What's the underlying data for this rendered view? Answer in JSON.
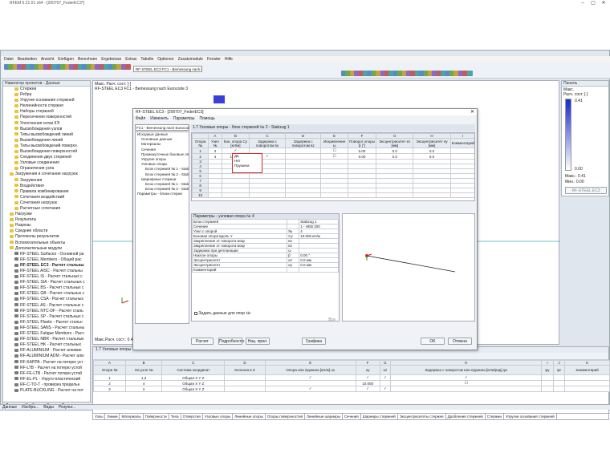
{
  "title": "RFEM 5.21.01 x64 - [200707_FederEC3*]",
  "menu": [
    "Datei",
    "Bearbeiten",
    "Ansicht",
    "Einfügen",
    "Berechnen",
    "Ergebnisse",
    "Extras",
    "Tabelle",
    "Optionen",
    "Zusatzmodule",
    "Fenster",
    "Hilfe"
  ],
  "toolbar": {
    "module_select": "RF-STEEL EC3 FC1 - Bemessung nach E"
  },
  "navigator": {
    "title": "Навигатор проектов - Данные",
    "items": [
      {
        "l": "Стержни",
        "d": 2,
        "i": "folder"
      },
      {
        "l": "Ребра",
        "d": 2,
        "i": "folder"
      },
      {
        "l": "Упругие основания стержней",
        "d": 2,
        "i": "folder"
      },
      {
        "l": "Нелинейности стержня",
        "d": 2,
        "i": "folder"
      },
      {
        "l": "Наборы стержней",
        "d": 2,
        "i": "folder"
      },
      {
        "l": "Пересечения поверхностей",
        "d": 2,
        "i": "folder"
      },
      {
        "l": "Уплотнения сетки КЭ",
        "d": 2,
        "i": "folder"
      },
      {
        "l": "Высвобождения узлов",
        "d": 2,
        "i": "folder"
      },
      {
        "l": "Типы высвобождений линий",
        "d": 2,
        "i": "folder"
      },
      {
        "l": "Высвобождения линий",
        "d": 2,
        "i": "folder"
      },
      {
        "l": "Типы высвобождений поверхн.",
        "d": 2,
        "i": "folder"
      },
      {
        "l": "Высвобождения поверхностей",
        "d": 2,
        "i": "folder"
      },
      {
        "l": "Соединения двух стержней",
        "d": 2,
        "i": "folder"
      },
      {
        "l": "Узловые соединения",
        "d": 2,
        "i": "folder"
      },
      {
        "l": "Ограничения узла",
        "d": 2,
        "i": "folder"
      },
      {
        "l": "Загружения и сочетания нагрузок",
        "d": 1,
        "i": "folder"
      },
      {
        "l": "Загружения",
        "d": 2,
        "i": "folder"
      },
      {
        "l": "Воздействия",
        "d": 2,
        "i": "folder"
      },
      {
        "l": "Правила комбинирования",
        "d": 2,
        "i": "folder"
      },
      {
        "l": "Сочетания воздействий",
        "d": 2,
        "i": "folder"
      },
      {
        "l": "Сочетания нагрузок",
        "d": 2,
        "i": "folder"
      },
      {
        "l": "Расчетные сочетания",
        "d": 2,
        "i": "folder"
      },
      {
        "l": "Нагрузки",
        "d": 1,
        "i": "folder"
      },
      {
        "l": "Результаты",
        "d": 1,
        "i": "folder"
      },
      {
        "l": "Разрезы",
        "d": 1,
        "i": "folder"
      },
      {
        "l": "Средние области",
        "d": 1,
        "i": "folder"
      },
      {
        "l": "Протоколы результатов",
        "d": 1,
        "i": "folder"
      },
      {
        "l": "Вспомогательные объекты",
        "d": 1,
        "i": "folder"
      },
      {
        "l": "Дополнительные модули",
        "d": 1,
        "i": "folder"
      },
      {
        "l": "RF-STEEL Surfaces - Основной ра",
        "d": 2,
        "i": "module"
      },
      {
        "l": "RF-STEEL Members - Общий рас",
        "d": 2,
        "i": "module"
      },
      {
        "l": "RF-STEEL EC3 - Расчет стальны",
        "d": 2,
        "i": "module",
        "b": true
      },
      {
        "l": "RF-STEEL AISC - Расчет стальны",
        "d": 2,
        "i": "module"
      },
      {
        "l": "RF-STEEL IS - Расчет стальных с",
        "d": 2,
        "i": "module"
      },
      {
        "l": "RF-STEEL SIA - Расчет стальных с",
        "d": 2,
        "i": "module"
      },
      {
        "l": "RF-STEEL BS - Расчет стальных с",
        "d": 2,
        "i": "module"
      },
      {
        "l": "RF-STEEL GB - Расчет стальных с",
        "d": 2,
        "i": "module"
      },
      {
        "l": "RF-STEEL CSA - Расчет стальных",
        "d": 2,
        "i": "module"
      },
      {
        "l": "RF-STEEL AS - Расчет стальных с",
        "d": 2,
        "i": "module"
      },
      {
        "l": "RF-STEEL NTC-DF - Расчет сталь",
        "d": 2,
        "i": "module"
      },
      {
        "l": "RF-STEEL SP - Расчет стальных с",
        "d": 2,
        "i": "module"
      },
      {
        "l": "RF-STEEL Plastic - Расчет стальн",
        "d": 2,
        "i": "module"
      },
      {
        "l": "RF-STEEL SANS - Расчет стальны",
        "d": 2,
        "i": "module"
      },
      {
        "l": "RF-STEEL Fatigue Members - Расч",
        "d": 2,
        "i": "module"
      },
      {
        "l": "RF-STEEL NBR - Расчет стальных",
        "d": 2,
        "i": "module"
      },
      {
        "l": "RF-STEEL HK - Расчет стальных",
        "d": 2,
        "i": "module"
      },
      {
        "l": "RF-ALUMINIUM - Расчет алюмин",
        "d": 2,
        "i": "module"
      },
      {
        "l": "RF-ALUMINIUM ADM - Расчет алю",
        "d": 2,
        "i": "module"
      },
      {
        "l": "RF-KAPPA - Расчет на потерю уст",
        "d": 2,
        "i": "module"
      },
      {
        "l": "RF-LTB - Расчет на потерю устой",
        "d": 2,
        "i": "module"
      },
      {
        "l": "RF-FE-LTB - Расчет потери устой",
        "d": 2,
        "i": "module"
      },
      {
        "l": "RF-EL-PL - Упруго-пластический",
        "d": 2,
        "i": "module"
      },
      {
        "l": "RF-C-TO-T - проверка предельн",
        "d": 2,
        "i": "module"
      },
      {
        "l": "PLATE-BUCKLING - Расчет на пот",
        "d": 2,
        "i": "module"
      }
    ],
    "bottom_tabs": [
      "Данные",
      "Изобра...",
      "Виды",
      "Результ..."
    ]
  },
  "viewport": {
    "line1": "Макс. Расч. сост. [-]",
    "line2": "RF-STEEL EC3 FC1 - Bemessung nach Eurocode 3",
    "bottom": "Макс.Расч. сост.: 0.41"
  },
  "panel": {
    "title": "Панель",
    "l1": "Макс.",
    "l2": "Расч. сост. [-]",
    "scale_top": "0.41",
    "scale_bot": "0.00",
    "max_label": "Макс.:",
    "max_val": "0.41",
    "min_label": "Мин.:",
    "min_val": "0.00",
    "module_btn": "RF-STEEL EC3"
  },
  "dialog": {
    "title": "RF-STEEL EC3 - [200707_FederEC3]",
    "menu": [
      "Файл",
      "Изменить",
      "Параметры",
      "Помощь"
    ],
    "case_select": "FC1 - Bemessung nach Eurocod",
    "tree_items": [
      "Исходные данные",
      "Основные данные",
      "Материалы",
      "Сечения",
      "Промежуточные боковые опо",
      "Упругие опоры",
      "Узловые опоры",
      "Блок стержней № 1 - Stab",
      "Блок стержней № 2 - Stab",
      "Шарнирные стержни",
      "Блок стержней № 1 - Stab",
      "Блок стержней № 2 - Stab",
      "Параметры - блоки стержн"
    ],
    "table_title": "1.7 Узловые опоры - блок стержней № 2 - Stabzug 1",
    "cols": [
      "A",
      "B",
      "C",
      "D",
      "E",
      "F",
      "G",
      "H",
      "I"
    ],
    "headers": [
      "Опора №",
      "Узел №",
      "Бок. опора Cy [кН/м]",
      "Задержка с поворотом вx",
      "Задержка с поворотом вz",
      "Искривление ω",
      "Поворот опоры β [°]",
      "Эксцентриситет ez [мм]",
      "Эксцентриситет ey [мм]",
      "Комментарий"
    ],
    "rows": [
      [
        "1",
        "3",
        "✓",
        "",
        "",
        "☐",
        "0.00",
        "0.0",
        "0.0",
        ""
      ],
      [
        "2",
        "4",
        "10.000",
        "✓",
        "",
        "☐",
        "0.00",
        "0.0",
        "0.0",
        ""
      ],
      [
        "3",
        "",
        "",
        "",
        "",
        "",
        "",
        "",
        "",
        ""
      ],
      [
        "4",
        "",
        "",
        "",
        "",
        "",
        "",
        "",
        "",
        ""
      ],
      [
        "5",
        "",
        "",
        "",
        "",
        "",
        "",
        "",
        "",
        ""
      ],
      [
        "6",
        "",
        "",
        "",
        "",
        "",
        "",
        "",
        "",
        ""
      ],
      [
        "7",
        "",
        "",
        "",
        "",
        "",
        "",
        "",
        "",
        ""
      ],
      [
        "8",
        "",
        "",
        "",
        "",
        "",
        "",
        "",
        "",
        ""
      ],
      [
        "9",
        "",
        "",
        "",
        "",
        "",
        "",
        "",
        "",
        ""
      ],
      [
        "10",
        "",
        "",
        "",
        "",
        "",
        "",
        "",
        "",
        ""
      ]
    ],
    "dropdown": [
      "Да",
      "Нет",
      "Пружина"
    ],
    "params_title": "Параметры - узловая опора № 4",
    "params": [
      [
        "Блок стержней",
        "",
        "Stabzug 1"
      ],
      [
        "Сечение",
        "",
        "1 - HEB 200"
      ],
      [
        "Узел с опорой",
        "№",
        "4"
      ],
      [
        "Боковая опора вдоль Y",
        "Cy",
        "10.000 кН/м"
      ],
      [
        "Закрепление от поворота вокр",
        "вх",
        ""
      ],
      [
        "Закрепление от поворота вокр",
        "вz",
        ""
      ],
      [
        "Задержка при депланации",
        "ω",
        ""
      ],
      [
        "Наклон опоры",
        "β",
        "0.00 °"
      ],
      [
        "Эксцентриситет",
        "ez",
        "0.0 мм"
      ],
      [
        "Эксцентриситет",
        "ey",
        "0.0 мм"
      ],
      [
        "Комментарий",
        "",
        ""
      ]
    ],
    "all_supports": "Задать данные для опор №:",
    "all_label": "Все",
    "buttons": {
      "calc": "Расчет",
      "details": "Подробности",
      "nat": "Нац. прил.",
      "graphic": "Графика",
      "ok": "OK",
      "cancel": "Отмена"
    }
  },
  "bottom": {
    "title": "1.7 Узловые опоры",
    "cols": [
      "A",
      "B",
      "C",
      "D",
      "E",
      "F",
      "G",
      "H",
      "I",
      "J",
      "K"
    ],
    "headers": [
      "Опора №",
      "На узле №",
      "Система координат",
      "Колонна в Z",
      "Опора или пружина [кН/м] ux",
      "uy",
      "uz",
      "Задержка с поворотом или пружина [кНм/рад] φx",
      "φy",
      "φz",
      "Комментарий"
    ],
    "rows": [
      [
        "1",
        "1,3",
        "Общая X Y Z",
        "",
        "✓",
        "✓",
        "✓",
        "✓",
        "",
        "",
        ""
      ],
      [
        "2",
        "4",
        "Общая X Y Z",
        "",
        "",
        "10.000",
        "",
        "☐",
        "",
        "",
        ""
      ],
      [
        "3",
        "2",
        "Общая X Y Z",
        "",
        "✓",
        "✓",
        "✓",
        "",
        "",
        "",
        ""
      ]
    ],
    "tabs": [
      "Узлы",
      "Линии",
      "Материалы",
      "Поверхности",
      "Тела",
      "Отверстия",
      "Узловые опоры",
      "Линейные опоры",
      "Опоры поверхностей",
      "Линейные шарниры",
      "Сечения",
      "Шарниры стержней",
      "Эксцентриситеты стержня",
      "Дробления стержней",
      "Стержни",
      "Упругие основания стержней"
    ]
  },
  "statusbar": [
    "Данные",
    "Изобра...",
    "Виды",
    "Результ..."
  ]
}
